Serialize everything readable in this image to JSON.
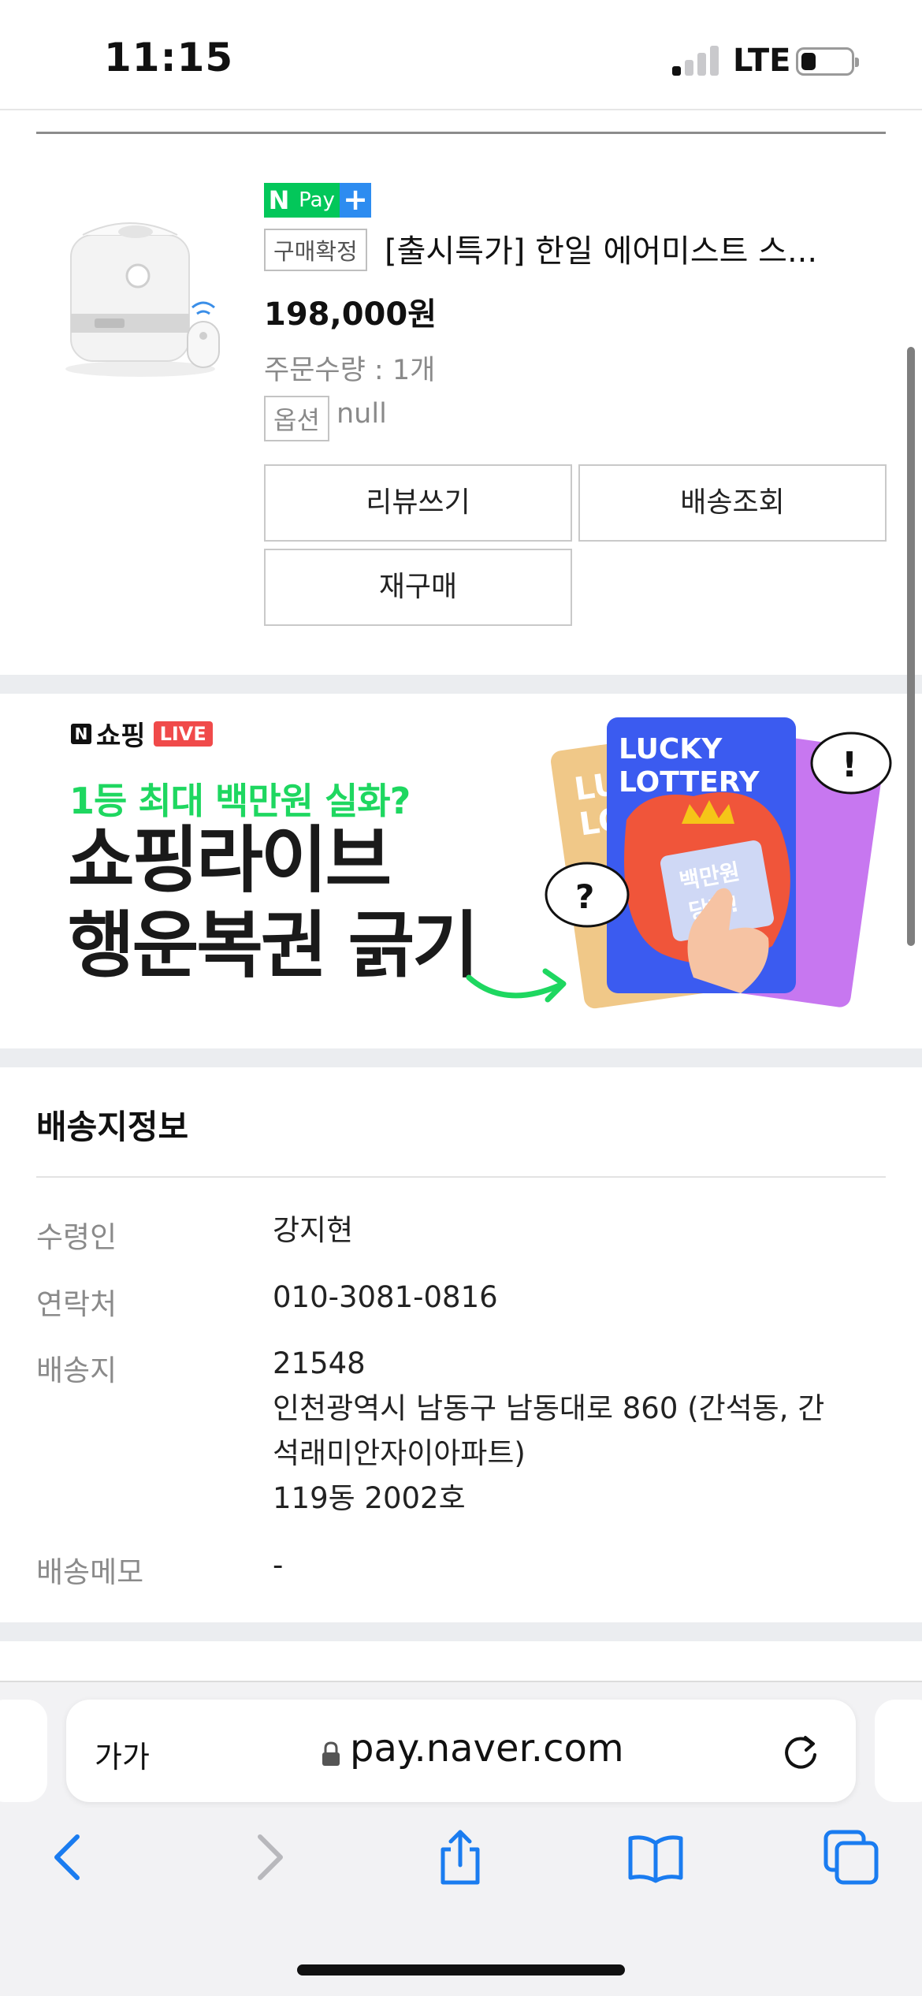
{
  "status_bar": {
    "time": "11:15",
    "network": "LTE"
  },
  "product": {
    "npay": {
      "n": "N",
      "pay": "Pay",
      "plus": "+"
    },
    "status_tag": "구매확정",
    "name": "[출시특가] 한일 에어미스트 스...",
    "price": "198,000원",
    "quantity": "주문수량 : 1개",
    "option_label": "옵션",
    "option_value": "null",
    "buttons": {
      "review": "리뷰쓰기",
      "track": "배송조회",
      "rebuy": "재구매"
    }
  },
  "banner": {
    "logo_text": "쇼핑",
    "logo_live": "LIVE",
    "subtitle": "1등 최대 백만원 실화?",
    "title_line1": "쇼핑라이브",
    "title_line2": "행운복권 긁기",
    "card_text_1": "LUCKY",
    "card_text_2": "LOTTERY",
    "ticket_text_1": "백만원",
    "ticket_text_2": "당첨!",
    "bubble_q": "?",
    "bubble_ex": "!",
    "colors": {
      "green": "#1ed760",
      "card_blue": "#3b5bf0",
      "card_red": "#f0553a",
      "card_purple": "#c777f0",
      "card_tan": "#f0c888"
    }
  },
  "delivery": {
    "title": "배송지정보",
    "rows": [
      {
        "label": "수령인",
        "lines": [
          "강지현"
        ]
      },
      {
        "label": "연락처",
        "lines": [
          "010-3081-0816"
        ]
      },
      {
        "label": "배송지",
        "lines": [
          "21548",
          "인천광역시 남동구 남동대로 860 (간석동, 간",
          "석래미안자이아파트)",
          "119동 2002호"
        ]
      },
      {
        "label": "배송메모",
        "lines": [
          "-"
        ]
      }
    ]
  },
  "browser": {
    "text_size_button": "가가",
    "url": "pay.naver.com"
  }
}
